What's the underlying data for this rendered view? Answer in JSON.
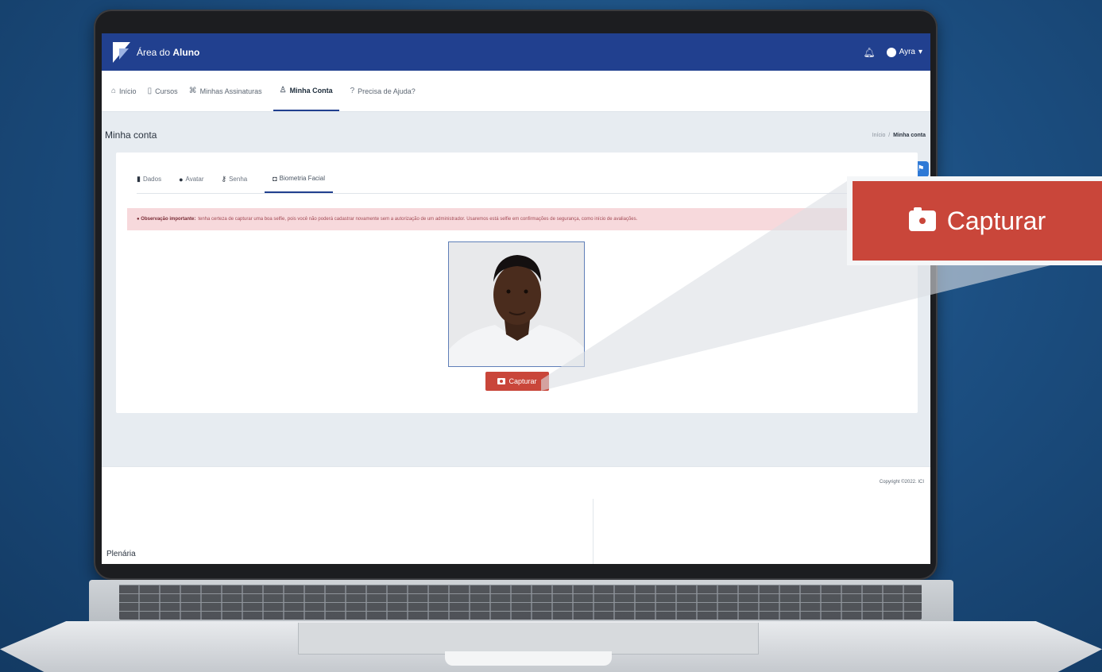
{
  "app": {
    "brand_prefix": "Área do",
    "brand_strong": "Aluno",
    "user_name": "Ayra"
  },
  "nav": {
    "items": [
      {
        "label": "Início"
      },
      {
        "label": "Cursos"
      },
      {
        "label": "Minhas Assinaturas"
      },
      {
        "label": "Minha Conta"
      },
      {
        "label": "Precisa de Ajuda?"
      }
    ]
  },
  "page": {
    "title": "Minha conta",
    "breadcrumb_home": "Início",
    "breadcrumb_current": "Minha conta"
  },
  "tabs": [
    {
      "label": "Dados"
    },
    {
      "label": "Avatar"
    },
    {
      "label": "Senha"
    },
    {
      "label": "Biometria Facial"
    }
  ],
  "alert": {
    "strong": "Observação importante:",
    "text": "tenha certeza de capturar uma boa selfie, pois você não poderá cadastrar novamente sem a autorização de um administrador. Usaremos está selfie em confirmações de segurança, como início de avaliações."
  },
  "capture_label": "Capturar",
  "footer": {
    "copyright": "Copyright ©2022. ICI",
    "plenaria": "Plenária"
  },
  "callout_label": "Capturar",
  "colors": {
    "primary": "#21408f",
    "danger": "#c9463a",
    "alert_bg": "#f7d9dc"
  }
}
